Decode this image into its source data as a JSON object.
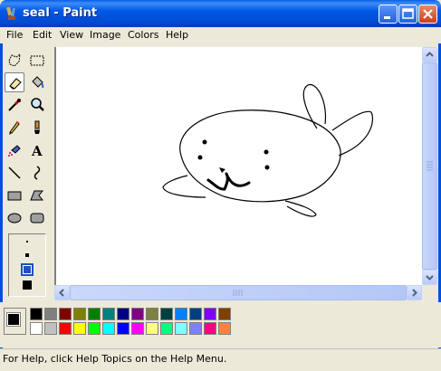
{
  "window": {
    "title": "seal - Paint",
    "icon": "paint-brush-icon"
  },
  "menu": [
    "File",
    "Edit",
    "View",
    "Image",
    "Colors",
    "Help"
  ],
  "tools": [
    {
      "name": "free-form-select-icon"
    },
    {
      "name": "rect-select-icon"
    },
    {
      "name": "eraser-icon"
    },
    {
      "name": "fill-bucket-icon"
    },
    {
      "name": "color-picker-icon"
    },
    {
      "name": "magnifier-icon"
    },
    {
      "name": "pencil-icon"
    },
    {
      "name": "brush-icon"
    },
    {
      "name": "airbrush-icon"
    },
    {
      "name": "text-icon"
    },
    {
      "name": "line-icon"
    },
    {
      "name": "curve-icon"
    },
    {
      "name": "rectangle-icon"
    },
    {
      "name": "polygon-icon"
    },
    {
      "name": "ellipse-icon"
    },
    {
      "name": "rounded-rect-icon"
    }
  ],
  "active_tool": "eraser-icon",
  "palette_top": [
    "#000000",
    "#808080",
    "#800000",
    "#808000",
    "#008000",
    "#008080",
    "#000080",
    "#800080",
    "#808040",
    "#004040",
    "#0080ff",
    "#004080",
    "#8000ff",
    "#804000"
  ],
  "palette_bottom": [
    "#ffffff",
    "#c0c0c0",
    "#ff0000",
    "#ffff00",
    "#00ff00",
    "#00ffff",
    "#0000ff",
    "#ff00ff",
    "#ffff80",
    "#00ff80",
    "#80ffff",
    "#8080ff",
    "#ff0080",
    "#ff8040"
  ],
  "colors": {
    "foreground": "#000000",
    "background": "#ffffff"
  },
  "status": {
    "help_text": "For Help, click Help Topics on the Help Menu."
  }
}
